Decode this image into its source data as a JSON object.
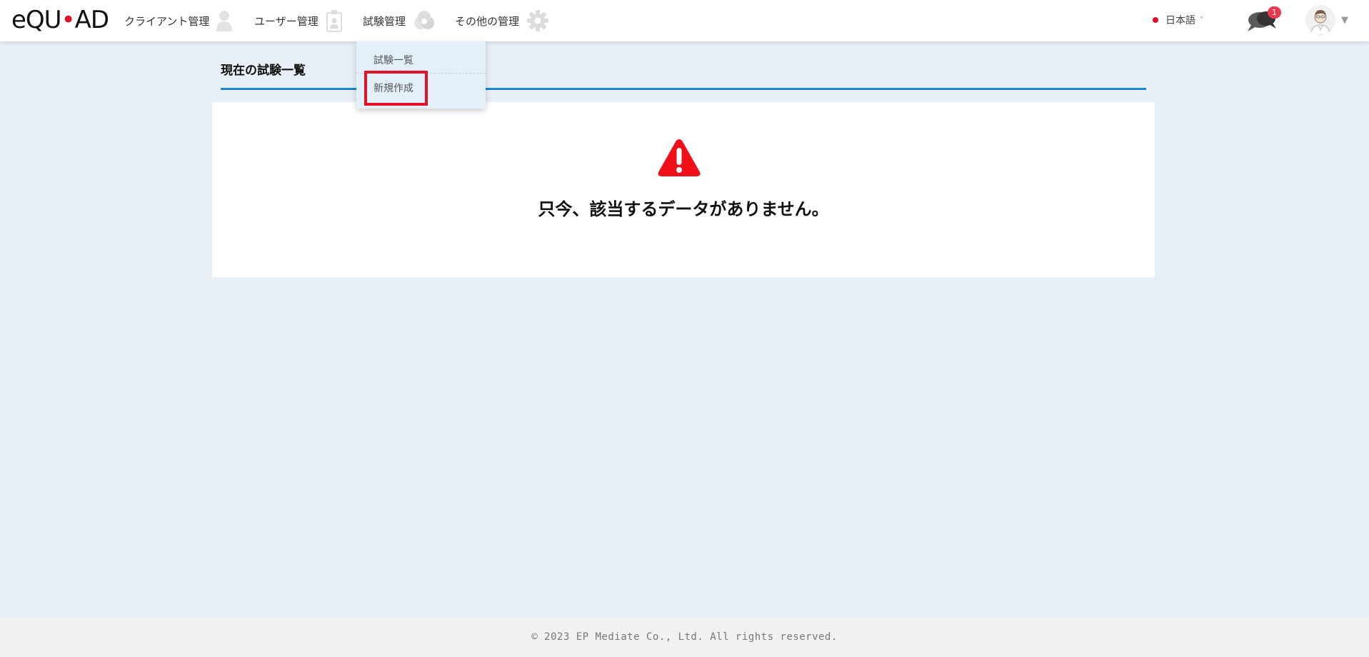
{
  "header": {
    "logo": {
      "prefix": "eQU",
      "dot": "•",
      "suffix": "AD",
      "accent_color": "#e0102a"
    },
    "nav": [
      {
        "label": "クライアント管理",
        "icon": "person-icon"
      },
      {
        "label": "ユーザー管理",
        "icon": "id-badge-icon"
      },
      {
        "label": "試験管理",
        "icon": "test-tubes-icon"
      },
      {
        "label": "その他の管理",
        "icon": "gear-icon"
      }
    ],
    "language": {
      "label": "日本語",
      "caret": "˅"
    },
    "notifications": {
      "count": "1",
      "icon": "chat-bubbles-icon",
      "badge_color": "#e8384f"
    },
    "user": {
      "icon": "avatar-icon",
      "caret": "▼"
    }
  },
  "dropdown": {
    "items": [
      {
        "label": "試験一覧"
      },
      {
        "label": "新規作成"
      }
    ],
    "highlight_color": "#e0142a"
  },
  "main": {
    "title": "現在の試験一覧",
    "accent_color": "#1a86cf",
    "empty_message": "只今、該当するデータがありません。",
    "warning_icon": "warning-triangle-icon",
    "warning_color": "#f0101a"
  },
  "footer": {
    "copyright": "© 2023 EP Mediate Co., Ltd. All rights reserved."
  }
}
